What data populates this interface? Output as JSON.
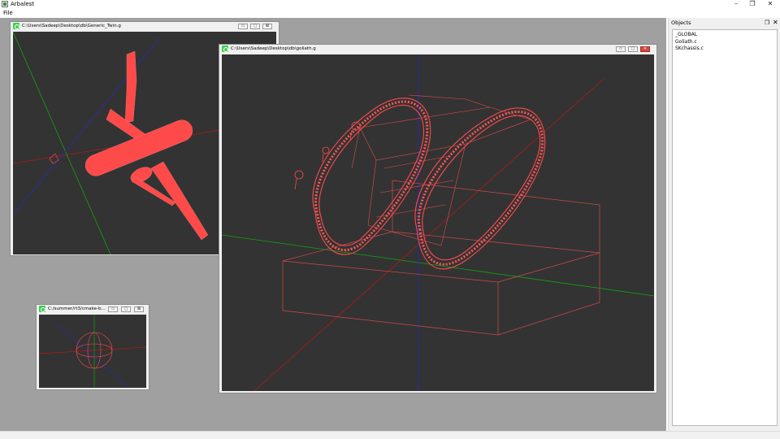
{
  "app": {
    "title": "Arbalest",
    "controls": {
      "minimize": "–",
      "maximize": "❐",
      "close": "✕"
    }
  },
  "menu": {
    "items": [
      "File"
    ]
  },
  "dock": {
    "title": "Objects",
    "float_glyph": "❐",
    "close_glyph": "✕",
    "items": [
      "_GLOBAL",
      "Goliath.c",
      "SKchassis.c"
    ]
  },
  "windows": [
    {
      "title": "C:\\Users\\Sadeep\\Desktop\\db\\Generic_Twin.g",
      "min": "▭",
      "max": "▢",
      "close": "⊠"
    },
    {
      "title": "C:\\Users\\Sadeep\\Desktop\\db\\goliath.g",
      "min": "▭",
      "max": "▢",
      "close": "✕"
    },
    {
      "title": "C:/summer/rt3/cmake-b...",
      "min": "▭",
      "max": "▢",
      "close": "⊠"
    }
  ],
  "colors": {
    "viewport_bg": "#333333",
    "geometry": "#ff4a4a",
    "axis_x": "#b01a1a",
    "axis_y": "#11a511",
    "axis_z": "#2a2ab8",
    "mdi_bg": "#a0a0a0"
  }
}
